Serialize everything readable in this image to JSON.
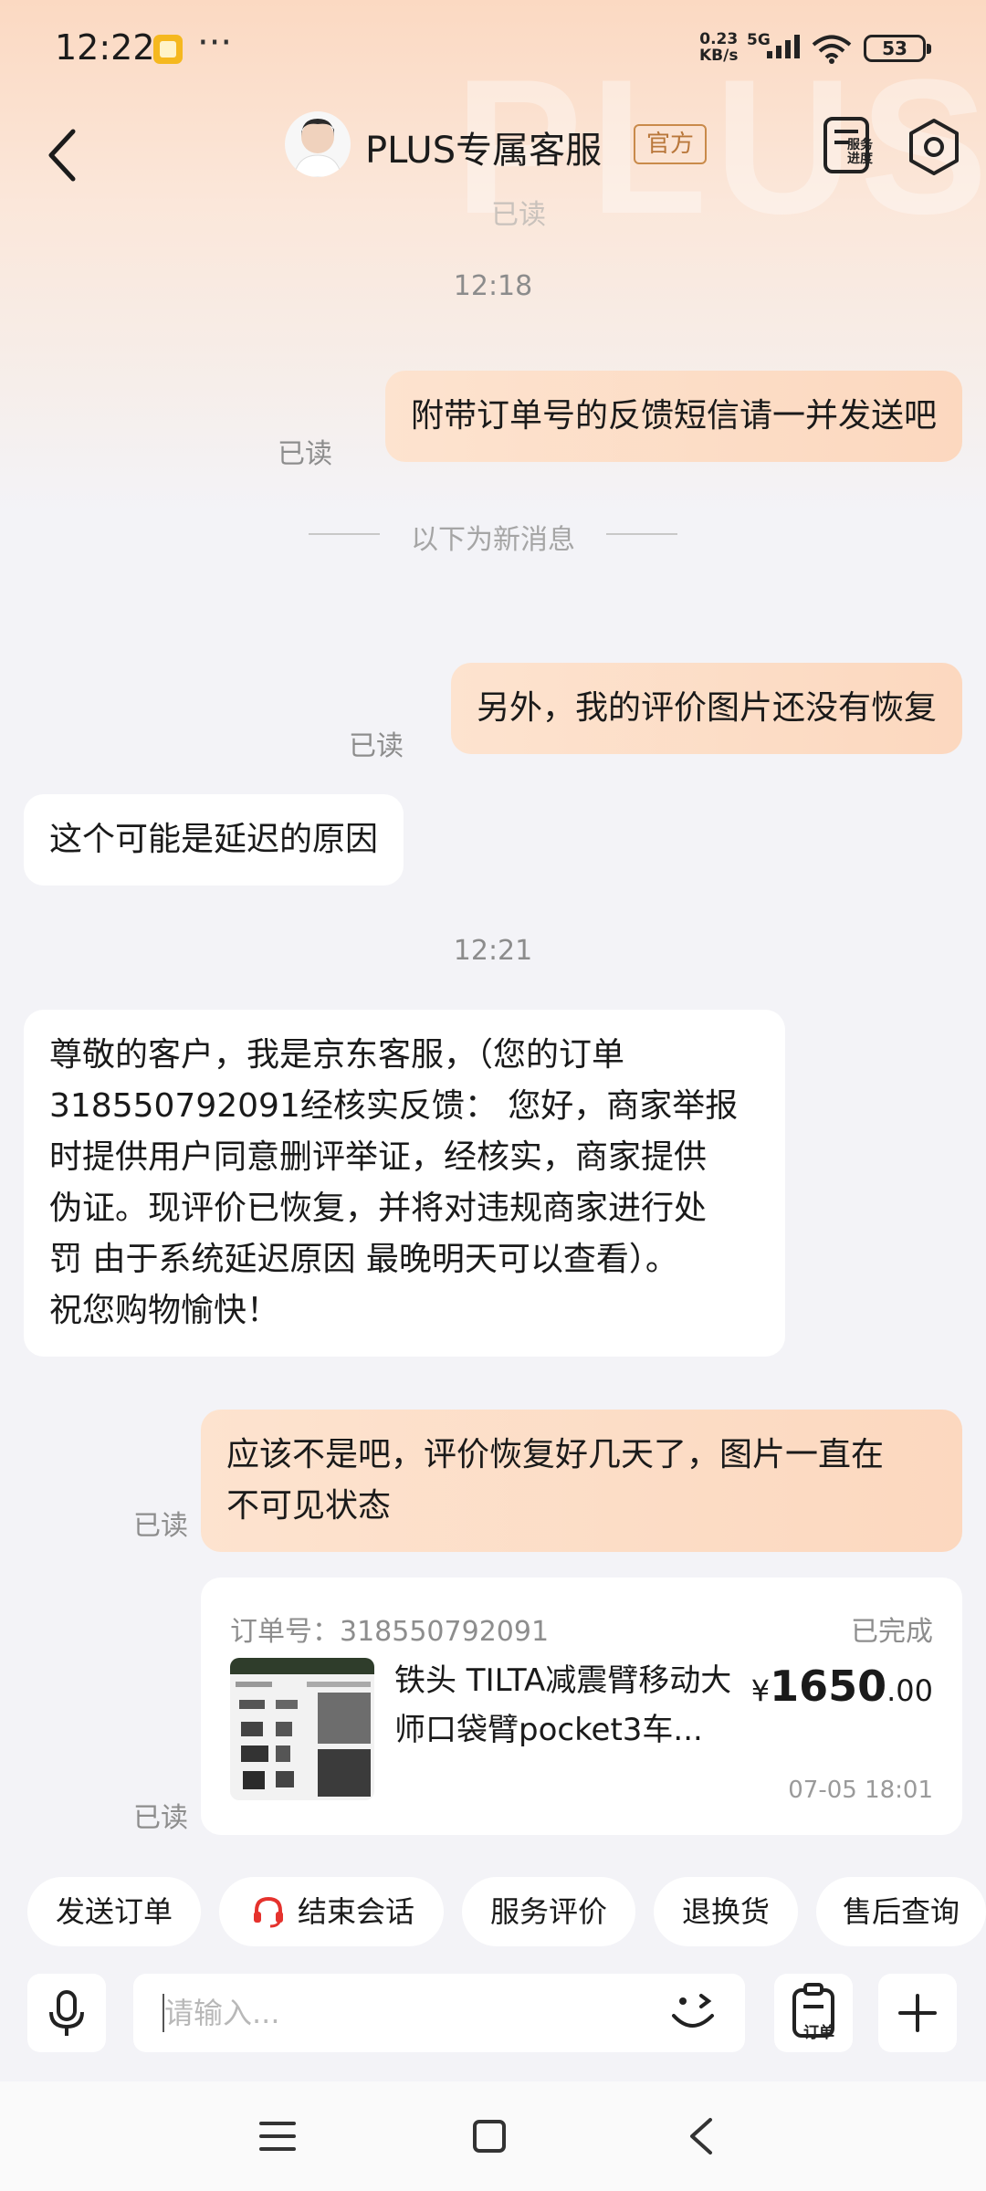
{
  "status_bar": {
    "time": "12:22",
    "dots": "···",
    "net_speed_value": "0.23",
    "net_speed_unit": "KB/s",
    "network_type": "5G",
    "battery": "53"
  },
  "header": {
    "title": "PLUS专属客服",
    "badge": "官方",
    "progress_label_line1": "服务",
    "progress_label_line2": "进度",
    "watermark": "PLUS",
    "faded_read": "已读"
  },
  "chat": {
    "time_1": "12:18",
    "msg_1": "附带订单号的反馈短信请一并发送吧",
    "msg_1_read": "已读",
    "divider": "以下为新消息",
    "msg_2": "另外，我的评价图片还没有恢复",
    "msg_2_read": "已读",
    "msg_3": "这个可能是延迟的原因",
    "time_2": "12:21",
    "msg_4_lines": [
      "尊敬的客户，我是京东客服，（您的订单",
      "318550792091经核实反馈： 您好，商家举报",
      "时提供用户同意删评举证，经核实，商家提供",
      "伪证。现评价已恢复，并将对违规商家进行处",
      "罚 由于系统延迟原因 最晚明天可以查看）。",
      "祝您购物愉快！"
    ],
    "msg_5_lines": [
      "应该不是吧，评价恢复好几天了，图片一直在",
      "不可见状态"
    ],
    "msg_5_read": "已读",
    "order_read": "已读"
  },
  "order_card": {
    "order_no": "订单号：318550792091",
    "status": "已完成",
    "name_line1": "铁头 TILTA减震臂移动大",
    "name_line2": "师口袋臂pocket3车...",
    "currency": "¥",
    "price_int": "1650",
    "price_dec": ".00",
    "date": "07-05 18:01"
  },
  "quick_actions": [
    "发送订单",
    "结束会话",
    "服务评价",
    "退换货",
    "售后查询"
  ],
  "input": {
    "placeholder": "请输入...",
    "order_button_label": "订单"
  },
  "colors": {
    "outgoing_bubble": "#fcdcc5",
    "incoming_bubble": "#ffffff",
    "badge_border": "#c98a4a",
    "end_session_icon": "#e5322d",
    "background": "#f3f3f7"
  }
}
